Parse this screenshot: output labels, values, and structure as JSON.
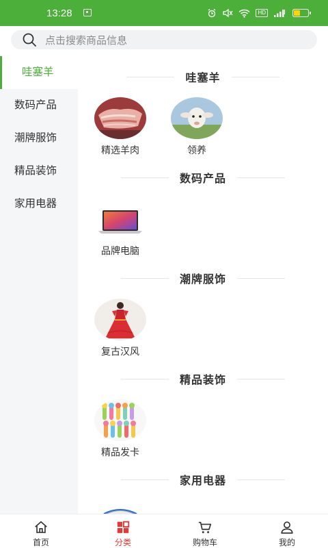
{
  "status_bar": {
    "time": "13:28",
    "icons": [
      "sim-icon",
      "alarm-icon",
      "mute-icon",
      "wifi-icon",
      "hd-badge",
      "signal-icon",
      "battery-icon"
    ],
    "hd_label": "HD",
    "battery_level": 0.4,
    "background_color": "#4caf3a"
  },
  "search": {
    "placeholder": "点击搜索商品信息"
  },
  "sidebar": {
    "active_index": 0,
    "accent_color": "#4caf3a",
    "items": [
      {
        "label": "哇塞羊"
      },
      {
        "label": "数码产品"
      },
      {
        "label": "潮牌服饰"
      },
      {
        "label": "精品装饰"
      },
      {
        "label": "家用电器"
      }
    ]
  },
  "sections": [
    {
      "title": "哇塞羊",
      "items": [
        {
          "label": "精选羊肉",
          "icon": "lamb-meat-image"
        },
        {
          "label": "领养",
          "icon": "sheep-image"
        }
      ]
    },
    {
      "title": "数码产品",
      "items": [
        {
          "label": "品牌电脑",
          "icon": "laptop-image"
        }
      ]
    },
    {
      "title": "潮牌服饰",
      "items": [
        {
          "label": "复古汉风",
          "icon": "hanfu-dress-image"
        }
      ]
    },
    {
      "title": "精品装饰",
      "items": [
        {
          "label": "精品发卡",
          "icon": "hairclips-image"
        }
      ]
    },
    {
      "title": "家用电器",
      "items": []
    }
  ],
  "tabbar": {
    "active_index": 1,
    "active_color": "#e53935",
    "tabs": [
      {
        "label": "首页",
        "icon": "home-icon"
      },
      {
        "label": "分类",
        "icon": "category-icon"
      },
      {
        "label": "购物车",
        "icon": "cart-icon"
      },
      {
        "label": "我的",
        "icon": "user-icon"
      }
    ]
  }
}
